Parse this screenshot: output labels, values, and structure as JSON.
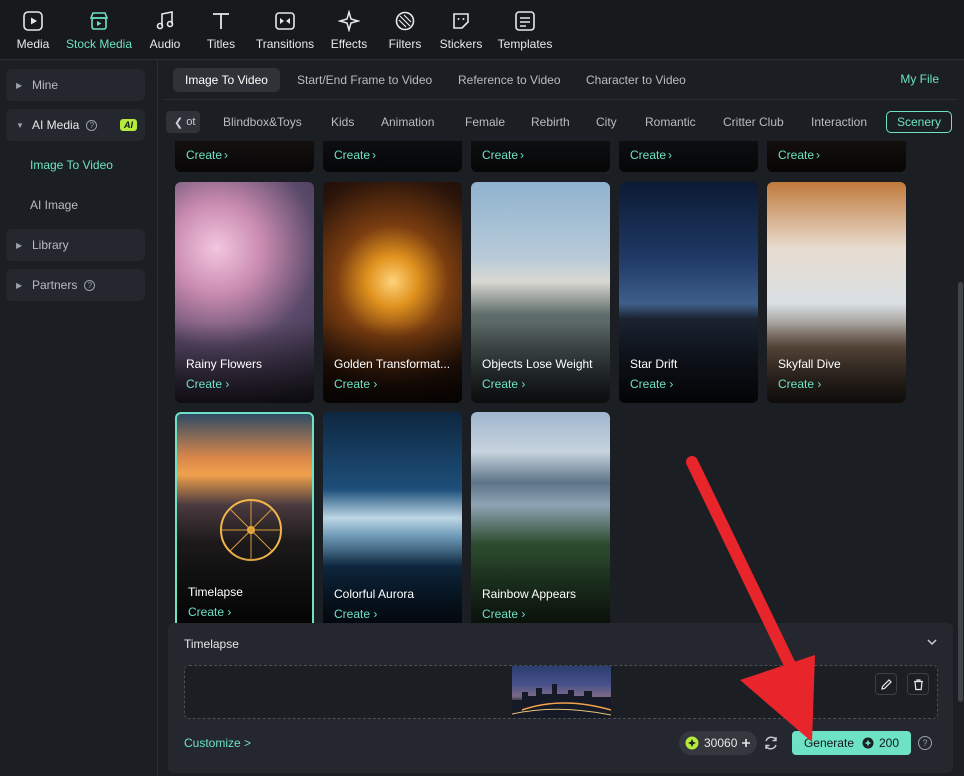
{
  "toolbar": {
    "items": [
      {
        "label": "Media",
        "icon": "media-icon"
      },
      {
        "label": "Stock Media",
        "icon": "stock-media-icon",
        "active": true
      },
      {
        "label": "Audio",
        "icon": "music-note-icon"
      },
      {
        "label": "Titles",
        "icon": "title-t-icon"
      },
      {
        "label": "Transitions",
        "icon": "transitions-icon"
      },
      {
        "label": "Effects",
        "icon": "effects-sparkle-icon"
      },
      {
        "label": "Filters",
        "icon": "filters-icon"
      },
      {
        "label": "Stickers",
        "icon": "sticker-icon"
      },
      {
        "label": "Templates",
        "icon": "templates-icon"
      }
    ]
  },
  "sidebar": {
    "mine": "Mine",
    "ai_media": "AI Media",
    "ai_badge": "AI",
    "image_to_video": "Image To Video",
    "ai_image": "AI Image",
    "library": "Library",
    "partners": "Partners"
  },
  "tabs": {
    "items": [
      "Image To Video",
      "Start/End Frame to Video",
      "Reference to Video",
      "Character to Video"
    ],
    "active": "Image To Video",
    "my_file": "My File"
  },
  "categories": {
    "items": [
      "ot",
      "Blindbox&Toys",
      "Kids",
      "Animation",
      "Female",
      "Rebirth",
      "City",
      "Romantic",
      "Critter Club",
      "Interaction",
      "Scenery"
    ],
    "active": "Scenery"
  },
  "cards": {
    "create_label": "Create",
    "items": [
      {
        "title": "Rainy Flowers"
      },
      {
        "title": "Golden Transformat..."
      },
      {
        "title": "Objects Lose Weight"
      },
      {
        "title": "Star Drift"
      },
      {
        "title": "Skyfall Dive"
      },
      {
        "title": "Timelapse",
        "selected": true
      },
      {
        "title": "Colorful Aurora"
      },
      {
        "title": "Rainbow Appears"
      }
    ]
  },
  "panel": {
    "title": "Timelapse",
    "customize": "Customize >",
    "credits": "30060",
    "generate": "Generate",
    "cost": "200"
  },
  "colors": {
    "accent": "#6de3c4",
    "annotation_arrow": "#e8252a",
    "ai_badge": "#b4ea3c"
  }
}
